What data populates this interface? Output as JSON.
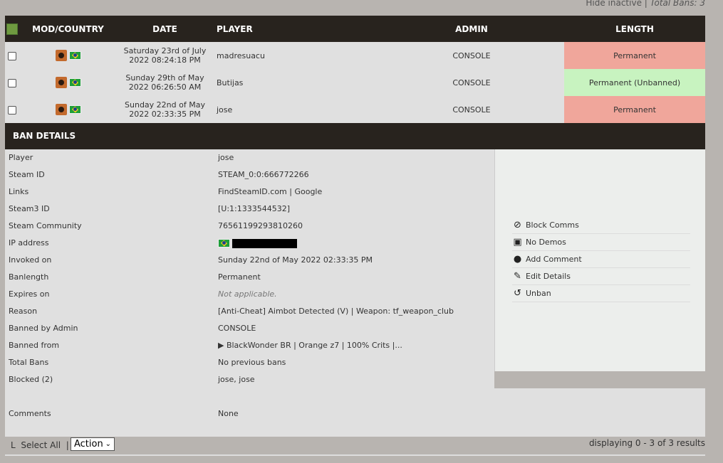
{
  "topbar": {
    "hide_inactive": "Hide inactive",
    "separator": "|",
    "total_bans": "Total Bans: 3"
  },
  "columns": {
    "mod_country": "MOD/COUNTRY",
    "date": "DATE",
    "player": "PLAYER",
    "admin": "ADMIN",
    "length": "LENGTH"
  },
  "rows": [
    {
      "date_line1": "Saturday 23rd of July",
      "date_line2": "2022 08:24:18 PM",
      "player": "madresuacu",
      "admin": "CONSOLE",
      "length": "Permanent"
    },
    {
      "date_line1": "Sunday 29th of May",
      "date_line2": "2022 06:26:50 AM",
      "player": "Butijas",
      "admin": "CONSOLE",
      "length": "Permanent (Unbanned)"
    },
    {
      "date_line1": "Sunday 22nd of May",
      "date_line2": "2022 02:33:35 PM",
      "player": "jose",
      "admin": "CONSOLE",
      "length": "Permanent"
    }
  ],
  "details": {
    "title": "BAN DETAILS",
    "fields": {
      "player": {
        "label": "Player",
        "value": "jose"
      },
      "steam_id": {
        "label": "Steam ID",
        "value": "STEAM_0:0:666772266"
      },
      "links": {
        "label": "Links",
        "value": "FindSteamID.com | Google"
      },
      "steam3_id": {
        "label": "Steam3 ID",
        "value": "[U:1:1333544532]"
      },
      "steam_community": {
        "label": "Steam Community",
        "value": "76561199293810260"
      },
      "ip_address": {
        "label": "IP address"
      },
      "invoked_on": {
        "label": "Invoked on",
        "value": "Sunday 22nd of May 2022 02:33:35 PM"
      },
      "banlength": {
        "label": "Banlength",
        "value": "Permanent"
      },
      "expires_on": {
        "label": "Expires on",
        "value": "Not applicable."
      },
      "reason": {
        "label": "Reason",
        "value": "[Anti-Cheat] Aimbot Detected (V) | Weapon: tf_weapon_club"
      },
      "banned_by": {
        "label": "Banned by Admin",
        "value": "CONSOLE"
      },
      "banned_from": {
        "label": "Banned from",
        "value": "▶ BlackWonder BR | Orange z7 | 100% Crits |..."
      },
      "total_bans": {
        "label": "Total Bans",
        "value": "No previous bans"
      },
      "blocked": {
        "label": "Blocked (2)",
        "value": "jose, jose"
      },
      "comments": {
        "label": "Comments",
        "value": "None"
      }
    },
    "actions": {
      "block_comms": "Block Comms",
      "no_demos": "No Demos",
      "add_comment": "Add Comment",
      "edit_details": "Edit Details",
      "unban": "Unban"
    }
  },
  "footer": {
    "select_all": "Select All",
    "separator": "|",
    "action_select": "Action",
    "results": "displaying 0 - 3 of 3 results"
  },
  "colors": {
    "header_bg": "#28231e",
    "permanent": "#f0a69b",
    "unbanned": "#c8f3c0"
  }
}
